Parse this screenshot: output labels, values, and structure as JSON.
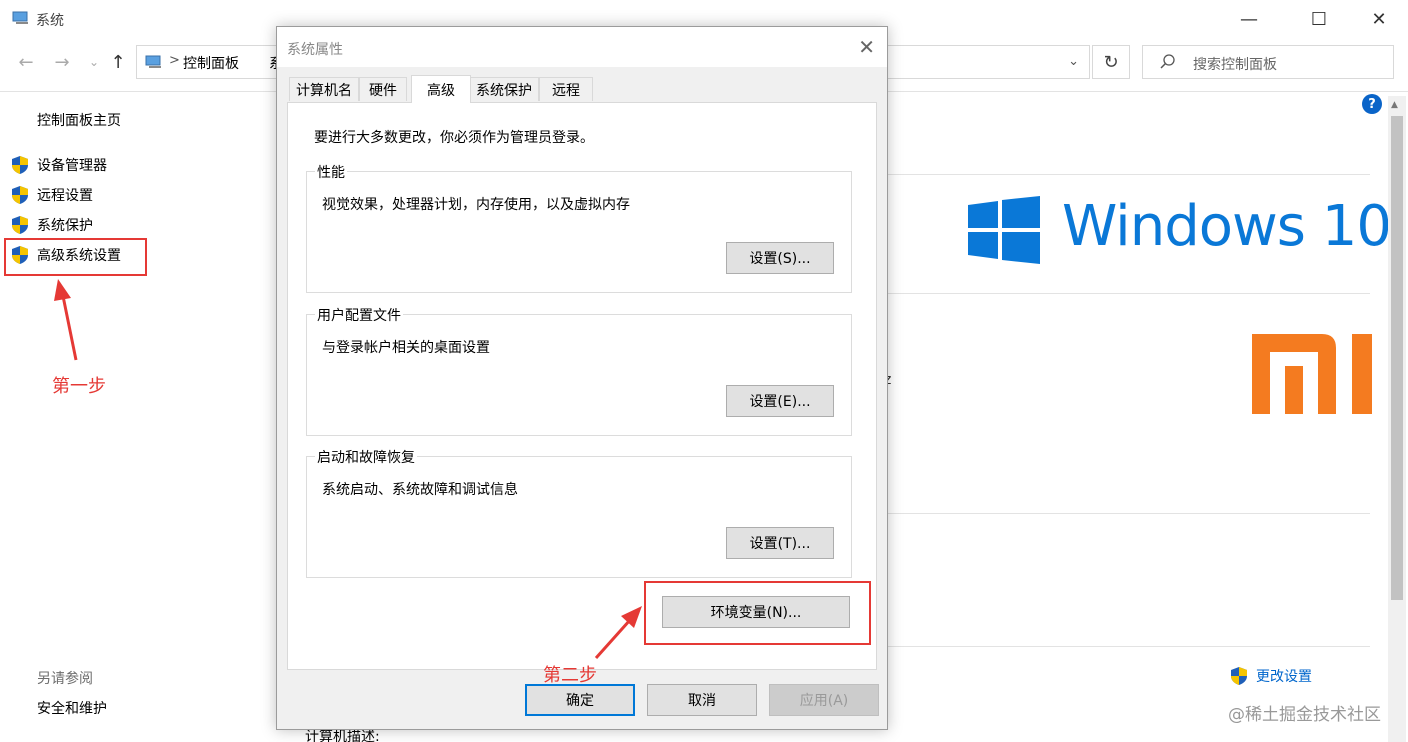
{
  "window": {
    "title": "系统",
    "controls": [
      "—",
      "☐",
      "✕"
    ]
  },
  "address_bar": {
    "separator": ">",
    "path": "控制面板",
    "path_clipped": "系",
    "dropdown": "⌄",
    "search_placeholder": "搜索控制面板"
  },
  "sidebar": {
    "home": "控制面板主页",
    "items": [
      {
        "label": "设备管理器"
      },
      {
        "label": "远程设置"
      },
      {
        "label": "系统保护"
      },
      {
        "label": "高级系统设置"
      }
    ],
    "see_also": "另请参阅",
    "security": "安全和维护"
  },
  "annotations": {
    "step1": "第一步",
    "step2": "第二步"
  },
  "content": {
    "windows_text": "Windows 10",
    "stray_char": "z",
    "change_settings": "更改设置",
    "help": "?",
    "computer_desc": "计算机描述:",
    "watermark": "@稀土掘金技术社区"
  },
  "dialog": {
    "title": "系统属性",
    "tabs": [
      {
        "label": "计算机名"
      },
      {
        "label": "硬件"
      },
      {
        "label": "高级"
      },
      {
        "label": "系统保护"
      },
      {
        "label": "远程"
      }
    ],
    "active_tab": "高级",
    "admin_note": "要进行大多数更改，你必须作为管理员登录。",
    "groups": [
      {
        "title": "性能",
        "desc": "视觉效果，处理器计划，内存使用，以及虚拟内存",
        "button": "设置(S)..."
      },
      {
        "title": "用户配置文件",
        "desc": "与登录帐户相关的桌面设置",
        "button": "设置(E)..."
      },
      {
        "title": "启动和故障恢复",
        "desc": "系统启动、系统故障和调试信息",
        "button": "设置(T)..."
      }
    ],
    "env_button": "环境变量(N)...",
    "ok": "确定",
    "cancel": "取消",
    "apply": "应用(A)"
  },
  "colors": {
    "accent": "#0078d7",
    "annotation": "#e53935",
    "windows_blue": "#0a78d7",
    "mi_orange": "#f47b20"
  }
}
